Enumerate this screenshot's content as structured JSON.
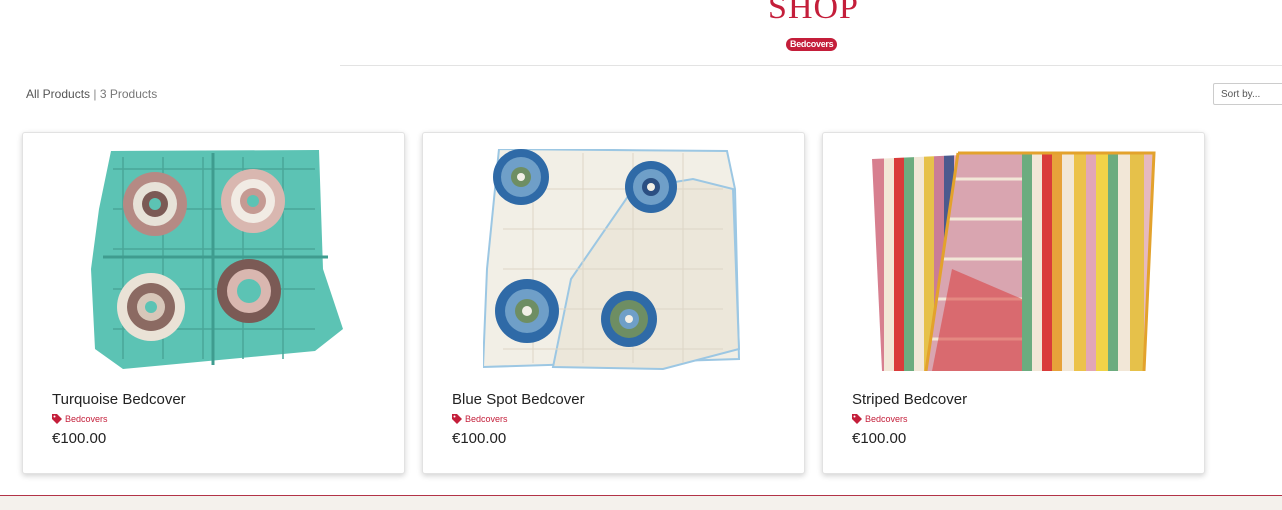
{
  "header": {
    "title": "SHOP",
    "category_badge": "Bedcovers"
  },
  "toolbar": {
    "all_products_link": "All Products",
    "separator": "|",
    "product_count": "3 Products",
    "sort_placeholder": "Sort by..."
  },
  "products": [
    {
      "name": "Turquoise Bedcover",
      "category": "Bedcovers",
      "price": "€100.00"
    },
    {
      "name": "Blue Spot Bedcover",
      "category": "Bedcovers",
      "price": "€100.00"
    },
    {
      "name": "Striped Bedcover",
      "category": "Bedcovers",
      "price": "€100.00"
    }
  ],
  "colors": {
    "brand": "#c41e3a",
    "turquoise": "#5cc3b4",
    "cream": "#f2efe6",
    "footer": "#f4f1ec"
  },
  "icons": [
    "tag-icon",
    "chevron-down-icon"
  ]
}
